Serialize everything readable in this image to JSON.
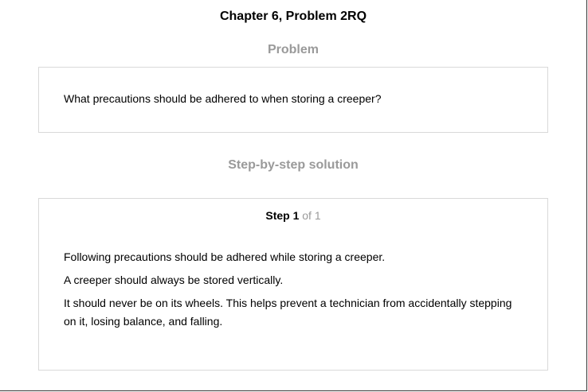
{
  "header": {
    "chapter_title": "Chapter 6, Problem 2RQ"
  },
  "problem": {
    "heading": "Problem",
    "text": "What precautions should be adhered to when storing a creeper?"
  },
  "solution": {
    "heading": "Step-by-step solution",
    "step": {
      "label": "Step 1",
      "of_label": " of 1",
      "paragraphs": [
        "Following precautions should be adhered while storing a creeper.",
        "A creeper should always be stored vertically.",
        "It should never be on its wheels. This helps prevent a technician from accidentally stepping on it, losing balance, and falling."
      ]
    }
  },
  "colors": {
    "heading_gray": "#9a9a9a",
    "box_border": "#d9d9d9",
    "text": "#000000"
  }
}
